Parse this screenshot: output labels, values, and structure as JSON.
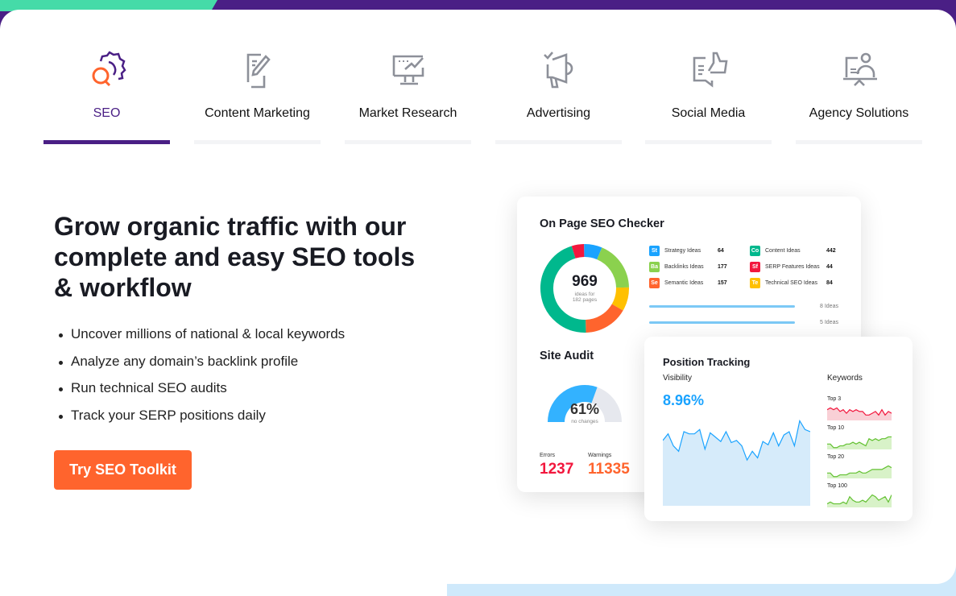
{
  "tabs": [
    {
      "label": "SEO",
      "icon": "seo-gear-search-icon",
      "active": true
    },
    {
      "label": "Content Marketing",
      "icon": "document-pencil-icon"
    },
    {
      "label": "Market Research",
      "icon": "monitor-chart-icon"
    },
    {
      "label": "Advertising",
      "icon": "megaphone-icon"
    },
    {
      "label": "Social Media",
      "icon": "thumbs-up-chat-icon"
    },
    {
      "label": "Agency Solutions",
      "icon": "presenter-icon"
    }
  ],
  "hero": {
    "heading": "Grow organic traffic with our complete and easy SEO tools & workflow",
    "bullets": [
      "Uncover millions of national & local keywords",
      "Analyze any domain’s backlink profile",
      "Run technical SEO audits",
      "Track your SERP positions daily"
    ],
    "cta": "Try SEO Toolkit"
  },
  "colors": {
    "brand": "#4a1f85",
    "accent": "#ff642d",
    "green": "#45dba8"
  },
  "onpage": {
    "title": "On Page SEO Checker",
    "total": "969",
    "subtitle1": "ideas for",
    "subtitle2": "182 pages",
    "items": [
      {
        "abbr": "St",
        "label": "Strategy Ideas",
        "value": "64",
        "color": "#1aa3ff"
      },
      {
        "abbr": "Ba",
        "label": "Backlinks Ideas",
        "value": "177",
        "color": "#8bd14e"
      },
      {
        "abbr": "Se",
        "label": "Semantic Ideas",
        "value": "157",
        "color": "#ff642d"
      },
      {
        "abbr": "Co",
        "label": "Content Ideas",
        "value": "442",
        "color": "#00b88d"
      },
      {
        "abbr": "Sf",
        "label": "SERP Features Ideas",
        "value": "44",
        "color": "#f2173d"
      },
      {
        "abbr": "Te",
        "label": "Technical SEO Ideas",
        "value": "84",
        "color": "#ffc000"
      }
    ],
    "bars": [
      {
        "label": "8 Ideas",
        "fraction": 0.87
      },
      {
        "label": "5 Ideas",
        "fraction": 0.87
      }
    ]
  },
  "audit": {
    "title": "Site Audit",
    "percent": "61%",
    "percent_value": 61,
    "note": "no changes",
    "errors_label": "Errors",
    "errors": "1237",
    "warnings_label": "Warnings",
    "warnings": "11335"
  },
  "tracking": {
    "title": "Position Tracking",
    "visibility_label": "Visibility",
    "visibility": "8.96%",
    "keywords_label": "Keywords",
    "visibility_series": [
      60,
      66,
      55,
      50,
      68,
      66,
      66,
      70,
      52,
      67,
      63,
      59,
      68,
      58,
      60,
      55,
      42,
      50,
      44,
      59,
      56,
      67,
      55,
      65,
      68,
      55,
      78,
      70,
      68
    ],
    "keywords": [
      {
        "label": "Top 3",
        "color": "#f2173d",
        "fill": "#f9d0d6",
        "series": [
          6,
          7,
          6,
          7,
          5,
          6,
          4,
          6,
          5,
          6,
          5,
          5,
          3,
          3,
          4,
          5,
          3,
          6,
          3,
          5,
          4
        ]
      },
      {
        "label": "Top 10",
        "color": "#63c132",
        "fill": "#d8f2c8",
        "series": [
          3,
          3,
          1,
          1,
          2,
          2,
          3,
          3,
          4,
          3,
          4,
          3,
          2,
          6,
          5,
          6,
          5,
          6,
          6,
          7,
          7
        ]
      },
      {
        "label": "Top 20",
        "color": "#63c132",
        "fill": "#d8f2c8",
        "series": [
          3,
          3,
          1,
          1,
          2,
          2,
          2,
          3,
          3,
          3,
          4,
          3,
          3,
          4,
          5,
          5,
          5,
          5,
          6,
          7,
          6
        ]
      },
      {
        "label": "Top 100",
        "color": "#63c132",
        "fill": "#d8f2c8",
        "series": [
          2,
          3,
          2,
          2,
          2,
          3,
          2,
          6,
          4,
          3,
          3,
          4,
          3,
          5,
          7,
          6,
          4,
          5,
          6,
          3,
          7
        ]
      }
    ]
  }
}
